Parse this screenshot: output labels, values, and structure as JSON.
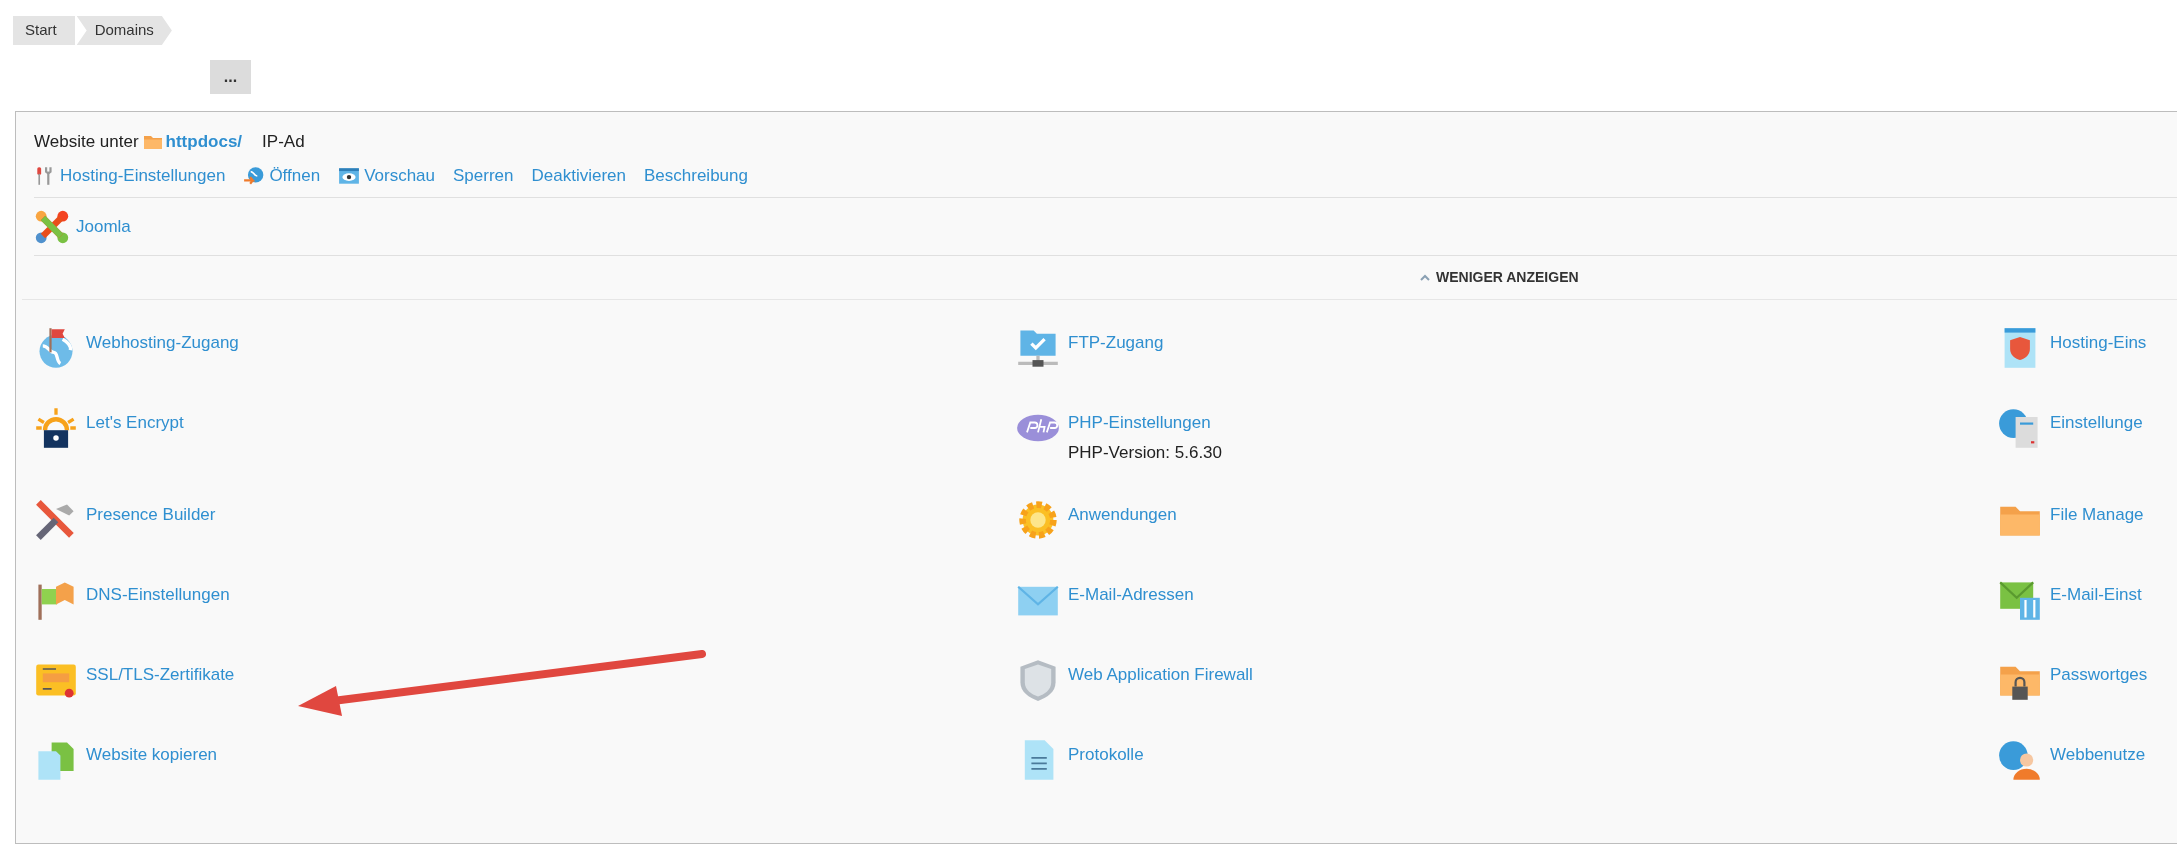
{
  "breadcrumbs": [
    "Start",
    "Domains"
  ],
  "more_button": "...",
  "website": {
    "label": "Website unter",
    "folder": "httpdocs/",
    "ip_label": "IP-Ad"
  },
  "actions": [
    "Hosting-Einstellungen",
    "Öffnen",
    "Vorschau",
    "Sperren",
    "Deaktivieren",
    "Beschreibung"
  ],
  "apps": [
    "Joomla"
  ],
  "toggle": "WENIGER ANZEIGEN",
  "tool_columns": [
    [
      {
        "label": "Webhosting-Zugang"
      },
      {
        "label": "Let's Encrypt"
      },
      {
        "label": "Presence Builder"
      },
      {
        "label": "DNS-Einstellungen"
      },
      {
        "label": "SSL/TLS-Zertifikate"
      },
      {
        "label": "Website kopieren"
      }
    ],
    [
      {
        "label": "FTP-Zugang"
      },
      {
        "label": "PHP-Einstellungen",
        "detail": "PHP-Version: 5.6.30"
      },
      {
        "label": "Anwendungen"
      },
      {
        "label": "E-Mail-Adressen"
      },
      {
        "label": "Web Application Firewall"
      },
      {
        "label": "Protokolle"
      }
    ],
    [
      {
        "label": "Hosting-Eins"
      },
      {
        "label": "Einstellunge"
      },
      {
        "label": "File Manage"
      },
      {
        "label": "E-Mail-Einst"
      },
      {
        "label": "Passwortges"
      },
      {
        "label": "Webbenutze"
      }
    ]
  ]
}
